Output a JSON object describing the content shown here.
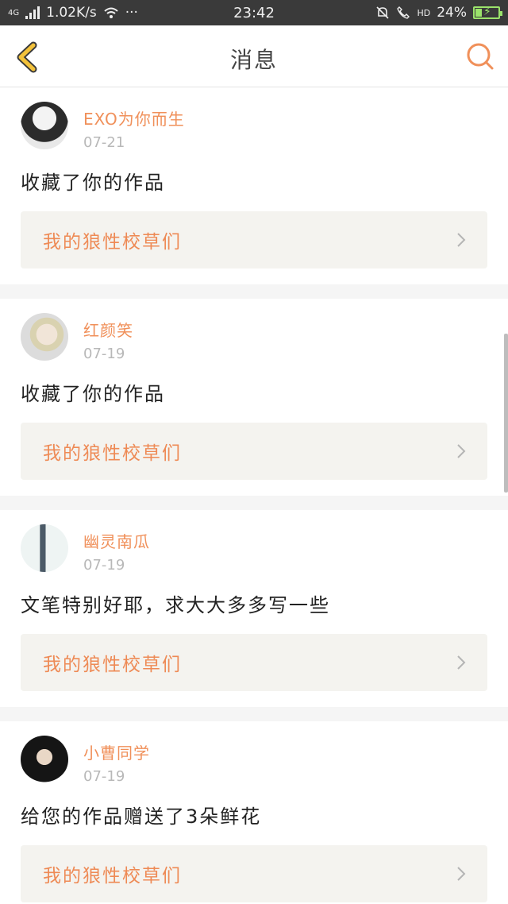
{
  "status_bar": {
    "network_type": "4G",
    "speed": "1.02K/s",
    "more": "···",
    "time": "23:42",
    "hd": "HD",
    "battery": "24%"
  },
  "nav": {
    "title": "消息"
  },
  "messages": [
    {
      "username": "EXO为你而生",
      "date": "07-21",
      "content": "收藏了你的作品",
      "work_title": "我的狼性校草们"
    },
    {
      "username": "红颜笑",
      "date": "07-19",
      "content": "收藏了你的作品",
      "work_title": "我的狼性校草们"
    },
    {
      "username": "幽灵南瓜",
      "date": "07-19",
      "content": "文笔特别好耶，求大大多多写一些",
      "work_title": "我的狼性校草们"
    },
    {
      "username": "小曹同学",
      "date": "07-19",
      "content": "给您的作品赠送了3朵鲜花",
      "work_title": "我的狼性校草们"
    }
  ],
  "colors": {
    "accent": "#f0905a",
    "back_icon": "#f3c23b",
    "status_bar": "#3a3a3a"
  }
}
